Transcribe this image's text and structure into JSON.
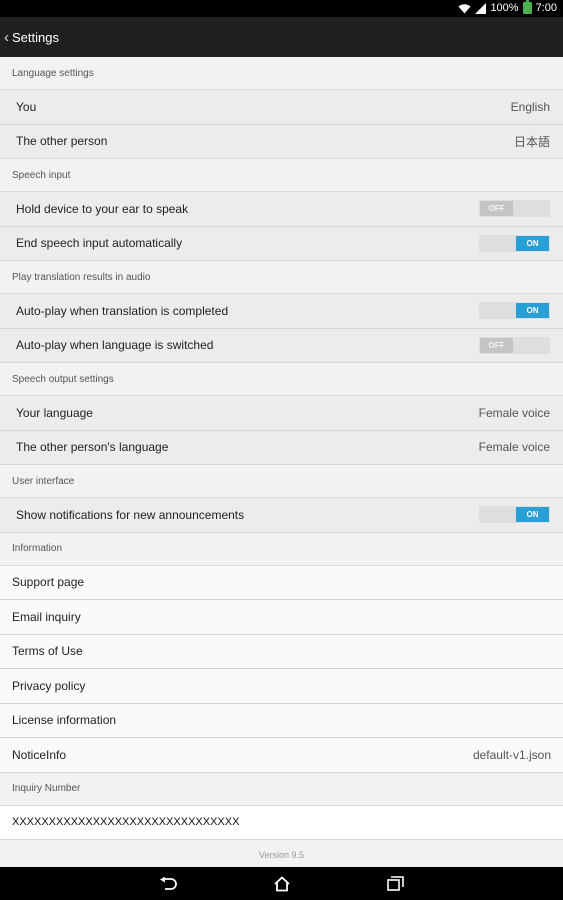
{
  "status_bar": {
    "battery": "100%",
    "time": "7:00"
  },
  "action_bar": {
    "title": "Settings"
  },
  "sections": {
    "language": {
      "header": "Language settings",
      "you_label": "You",
      "you_value": "English",
      "other_label": "The other person",
      "other_value": "日本語"
    },
    "speech_input": {
      "header": "Speech input",
      "hold_label": "Hold device to your ear to speak",
      "hold_state": "OFF",
      "end_label": "End speech input automatically",
      "end_state": "ON"
    },
    "play_audio": {
      "header": "Play translation results in audio",
      "completed_label": "Auto-play when translation is completed",
      "completed_state": "ON",
      "switched_label": "Auto-play when language is switched",
      "switched_state": "OFF"
    },
    "speech_output": {
      "header": "Speech output settings",
      "your_label": "Your language",
      "your_value": "Female voice",
      "other_label": "The other person's language",
      "other_value": "Female voice"
    },
    "user_interface": {
      "header": "User interface",
      "notif_label": "Show notifications for new announcements",
      "notif_state": "ON"
    },
    "information": {
      "header": "Information",
      "support": "Support page",
      "email": "Email inquiry",
      "terms": "Terms of Use",
      "privacy": "Privacy policy",
      "license": "License information",
      "notice_label": "NoticeInfo",
      "notice_value": "default-v1.json"
    },
    "inquiry": {
      "header": "Inquiry Number",
      "value": "XXXXXXXXXXXXXXXXXXXXXXXXXXXXXXX"
    }
  },
  "version": "Version 9.5",
  "colors": {
    "accent": "#2a9fd6",
    "action_bar": "#1f1f1f"
  },
  "icons": [
    "wifi-icon",
    "signal-icon",
    "battery-icon",
    "back-chevron-icon",
    "nav-back-icon",
    "nav-home-icon",
    "nav-recents-icon"
  ]
}
